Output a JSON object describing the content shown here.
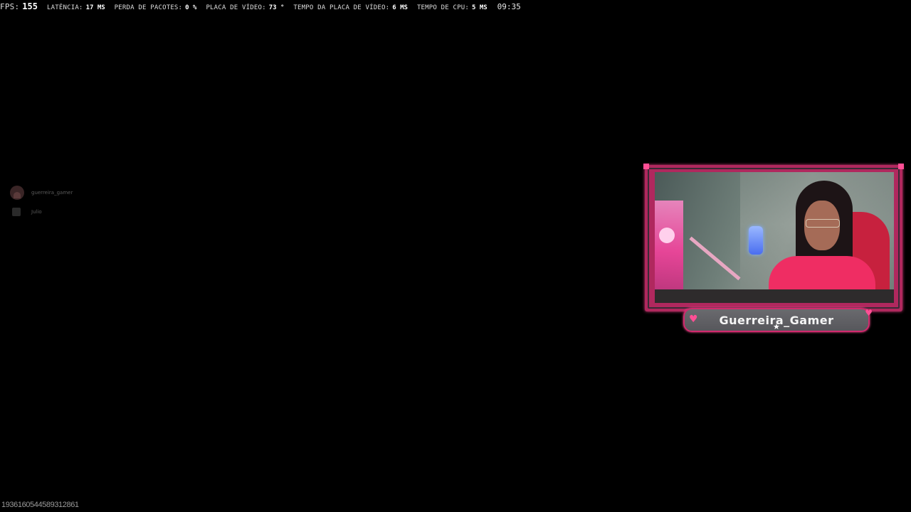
{
  "performance_overlay": {
    "fps": {
      "label": "FPS:",
      "value": "155"
    },
    "latency": {
      "label": "LATÊNCIA:",
      "value": "17 MS"
    },
    "packet_loss": {
      "label": "PERDA DE PACOTES:",
      "value": "0 %"
    },
    "gpu_temp": {
      "label": "PLACA DE VÍDEO:",
      "value": "73 °"
    },
    "gpu_time": {
      "label": "TEMPO DA PLACA DE VÍDEO:",
      "value": "6 MS"
    },
    "cpu_time": {
      "label": "TEMPO DE CPU:",
      "value": "5 MS"
    },
    "clock": "09:35"
  },
  "voice_overlay": {
    "users": [
      {
        "name": "guerreira_gamer",
        "avatar_icon": "avatar-icon"
      },
      {
        "name": "Julio",
        "avatar_icon": "avatar-icon"
      }
    ]
  },
  "webcam": {
    "streamer_name": "Guerreira_Gamer",
    "frame_color": "#d12a6e",
    "accent_color": "#ff4f95",
    "decorations": [
      "heart-icon",
      "heart-icon",
      "star-icon"
    ]
  },
  "footer": {
    "session_id": "1936160544589312861"
  }
}
